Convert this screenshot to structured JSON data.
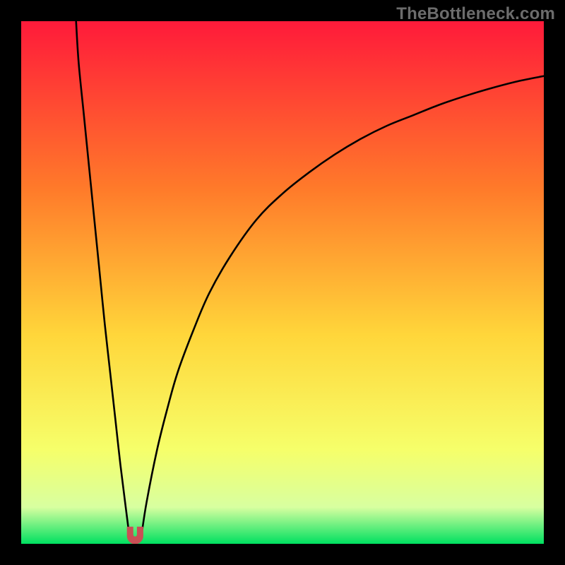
{
  "watermark": "TheBottleneck.com",
  "colors": {
    "frame": "#000000",
    "gradient_top": "#ff1a3a",
    "gradient_mid1": "#ff7a2a",
    "gradient_mid2": "#ffd63a",
    "gradient_mid3": "#f6ff6a",
    "gradient_pastel": "#d8ffa0",
    "gradient_bottom": "#00e060",
    "curve": "#000000",
    "marker_fill": "#c94f55",
    "marker_stroke": "#c94f55"
  },
  "chart_data": {
    "type": "line",
    "title": "",
    "xlabel": "",
    "ylabel": "",
    "xlim": [
      0,
      100
    ],
    "ylim": [
      0,
      100
    ],
    "series": [
      {
        "name": "left-branch",
        "x": [
          10.5,
          11.0,
          12.0,
          13.0,
          14.0,
          15.0,
          16.0,
          17.0,
          18.0,
          19.0,
          20.0,
          20.7
        ],
        "y": [
          100,
          92,
          82,
          72,
          62,
          52,
          42,
          33,
          24,
          15,
          7,
          1.5
        ]
      },
      {
        "name": "right-branch",
        "x": [
          23.0,
          24.0,
          26.0,
          28.0,
          30.0,
          33.0,
          36.0,
          40.0,
          45.0,
          50.0,
          55.0,
          60.0,
          65.0,
          70.0,
          75.0,
          80.0,
          85.0,
          90.0,
          95.0,
          100.0
        ],
        "y": [
          1.5,
          8,
          18,
          26,
          33,
          41,
          48,
          55,
          62,
          67,
          71,
          74.5,
          77.5,
          80,
          82,
          84,
          85.7,
          87.2,
          88.5,
          89.5
        ]
      }
    ],
    "marker": {
      "name": "minimum-region",
      "x_range": [
        20.3,
        23.3
      ],
      "y_range": [
        0.0,
        3.2
      ]
    }
  }
}
